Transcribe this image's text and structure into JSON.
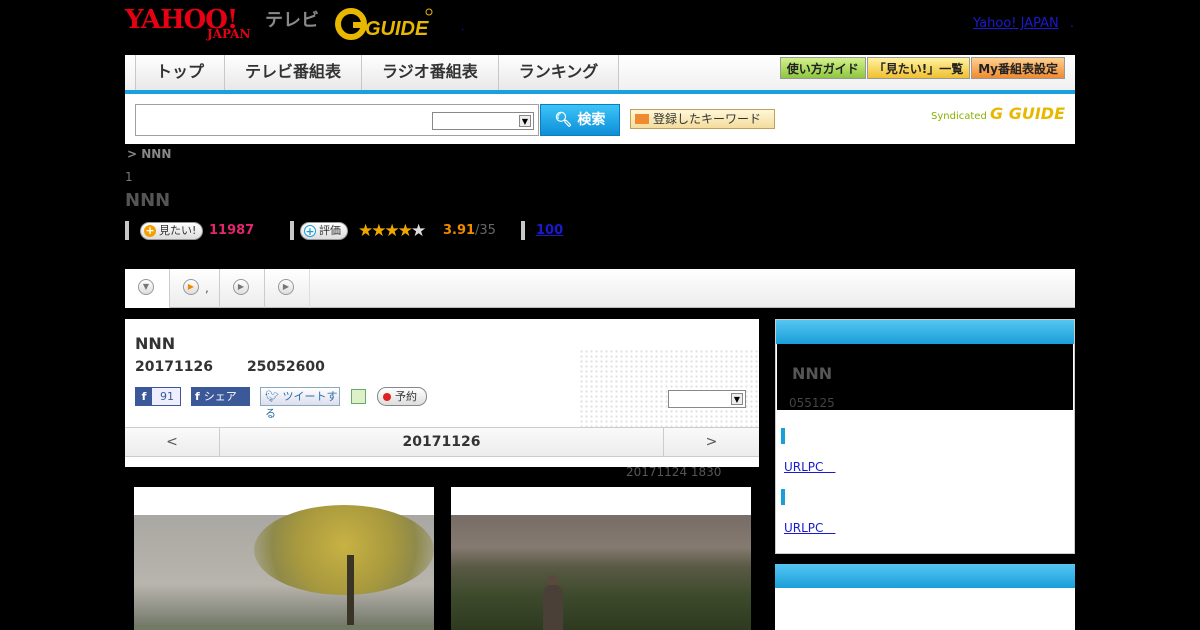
{
  "header": {
    "yahoo_logo_main": "YAHOO!",
    "yahoo_logo_sub": "JAPAN",
    "tv_label": "テレビ",
    "gguide_logo": "G GUIDE",
    "yahoo_japan_link": "Yahoo! JAPAN",
    "dot_left": ".",
    "dot_right": "."
  },
  "nav": {
    "tabs": [
      "トップ",
      "テレビ番組表",
      "ラジオ番組表",
      "ランキング"
    ],
    "buttons": [
      "使い方ガイド",
      "「見たい!」一覧",
      "My番組表設定"
    ]
  },
  "search": {
    "input_value": "",
    "select_value": "",
    "button_label": "検索",
    "keyword_button": "登録したキーワード",
    "syndicated_label": "Syndicated",
    "syndicated_brand": "G GUIDE"
  },
  "program": {
    "breadcrumb": "> NNN",
    "episode_count": "1",
    "title": "NNN",
    "want_button": "見たい!",
    "want_count": "11987",
    "rate_button": "評価",
    "rating": 3.91,
    "rating_text": "3.91",
    "rating_sub": "/35",
    "review_link": "100"
  },
  "subtabs": {
    "comma": ","
  },
  "episode": {
    "title": "NNN",
    "date": "20171126",
    "code": "25052600",
    "fb_count": "91",
    "fb_share": "シェア",
    "tweet": "ツイートする",
    "reserve": "予約",
    "select_value": "",
    "pager_prev": "<",
    "pager_date": "20171126",
    "pager_next": ">",
    "updated": "20171124  1830"
  },
  "sidebar": {
    "title": "NNN",
    "subtitle": "055125",
    "links": [
      "URLPC　",
      "URLPC　"
    ]
  },
  "colors": {
    "accent": "#1a9ed8",
    "want_pink": "#e0286a",
    "rating_orange": "#f08a00",
    "link_blue": "#1a1ad0"
  }
}
